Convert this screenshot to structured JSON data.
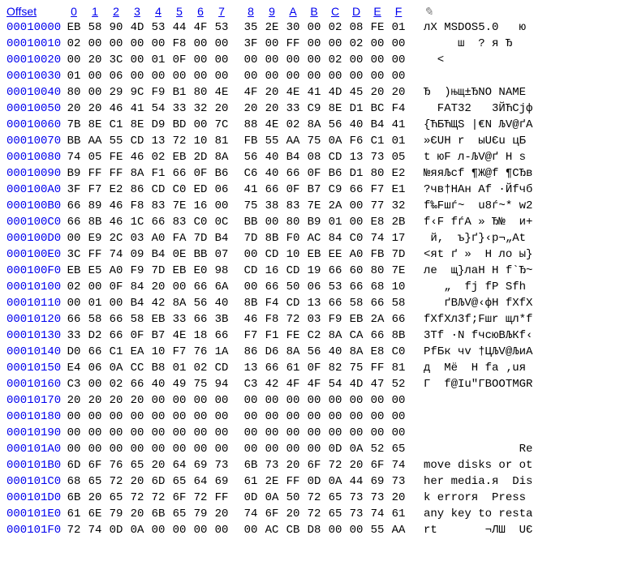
{
  "header": {
    "offset_label": "Offset",
    "columns": [
      "0",
      "1",
      "2",
      "3",
      "4",
      "5",
      "6",
      "7",
      "8",
      "9",
      "A",
      "B",
      "C",
      "D",
      "E",
      "F"
    ],
    "ascii_header_icon": "slash-icon"
  },
  "rows": [
    {
      "offset": "00010000",
      "hex": [
        "EB",
        "58",
        "90",
        "4D",
        "53",
        "44",
        "4F",
        "53",
        "35",
        "2E",
        "30",
        "00",
        "02",
        "08",
        "FE",
        "01"
      ],
      "ascii": "лX MSDOS5.0   ю"
    },
    {
      "offset": "00010010",
      "hex": [
        "02",
        "00",
        "00",
        "00",
        "00",
        "F8",
        "00",
        "00",
        "3F",
        "00",
        "FF",
        "00",
        "00",
        "02",
        "00",
        "00"
      ],
      "ascii": "     ш  ? я Ђ"
    },
    {
      "offset": "00010020",
      "hex": [
        "00",
        "20",
        "3C",
        "00",
        "01",
        "0F",
        "00",
        "00",
        "00",
        "00",
        "00",
        "00",
        "02",
        "00",
        "00",
        "00"
      ],
      "ascii": "  <"
    },
    {
      "offset": "00010030",
      "hex": [
        "01",
        "00",
        "06",
        "00",
        "00",
        "00",
        "00",
        "00",
        "00",
        "00",
        "00",
        "00",
        "00",
        "00",
        "00",
        "00"
      ],
      "ascii": ""
    },
    {
      "offset": "00010040",
      "hex": [
        "80",
        "00",
        "29",
        "9C",
        "F9",
        "B1",
        "80",
        "4E",
        "4F",
        "20",
        "4E",
        "41",
        "4D",
        "45",
        "20",
        "20"
      ],
      "ascii": "Ђ  )њщ±ЂNO NAME"
    },
    {
      "offset": "00010050",
      "hex": [
        "20",
        "20",
        "46",
        "41",
        "54",
        "33",
        "32",
        "20",
        "20",
        "20",
        "33",
        "C9",
        "8E",
        "D1",
        "BC",
        "F4"
      ],
      "ascii": "  FAT32   3ЙЋСјф"
    },
    {
      "offset": "00010060",
      "hex": [
        "7B",
        "8E",
        "C1",
        "8E",
        "D9",
        "BD",
        "00",
        "7C",
        "88",
        "4E",
        "02",
        "8A",
        "56",
        "40",
        "B4",
        "41"
      ],
      "ascii": "{ЋБЋЩЅ |€N ЉV@ґA"
    },
    {
      "offset": "00010070",
      "hex": [
        "BB",
        "AA",
        "55",
        "CD",
        "13",
        "72",
        "10",
        "81",
        "FB",
        "55",
        "AA",
        "75",
        "0A",
        "F6",
        "C1",
        "01"
      ],
      "ascii": "»ЄUН r  ыUЄu цБ"
    },
    {
      "offset": "00010080",
      "hex": [
        "74",
        "05",
        "FE",
        "46",
        "02",
        "EB",
        "2D",
        "8A",
        "56",
        "40",
        "B4",
        "08",
        "CD",
        "13",
        "73",
        "05"
      ],
      "ascii": "t юF л-ЉV@ґ Н s"
    },
    {
      "offset": "00010090",
      "hex": [
        "B9",
        "FF",
        "FF",
        "8A",
        "F1",
        "66",
        "0F",
        "B6",
        "C6",
        "40",
        "66",
        "0F",
        "B6",
        "D1",
        "80",
        "E2"
      ],
      "ascii": "№яяЉсf ¶Ж@f ¶СЂв"
    },
    {
      "offset": "000100A0",
      "hex": [
        "3F",
        "F7",
        "E2",
        "86",
        "CD",
        "C0",
        "ED",
        "06",
        "41",
        "66",
        "0F",
        "B7",
        "C9",
        "66",
        "F7",
        "E1"
      ],
      "ascii": "?чв†НАн Af ·Йfчб"
    },
    {
      "offset": "000100B0",
      "hex": [
        "66",
        "89",
        "46",
        "F8",
        "83",
        "7E",
        "16",
        "00",
        "75",
        "38",
        "83",
        "7E",
        "2A",
        "00",
        "77",
        "32"
      ],
      "ascii": "f‰Fшѓ~  u8ѓ~* w2"
    },
    {
      "offset": "000100C0",
      "hex": [
        "66",
        "8B",
        "46",
        "1C",
        "66",
        "83",
        "C0",
        "0C",
        "BB",
        "00",
        "80",
        "B9",
        "01",
        "00",
        "E8",
        "2B"
      ],
      "ascii": "f‹F fѓА » Ђ№  и+"
    },
    {
      "offset": "000100D0",
      "hex": [
        "00",
        "E9",
        "2C",
        "03",
        "A0",
        "FA",
        "7D",
        "B4",
        "7D",
        "8B",
        "F0",
        "AC",
        "84",
        "C0",
        "74",
        "17"
      ],
      "ascii": " й,  ъ}ґ}‹р¬„Аt"
    },
    {
      "offset": "000100E0",
      "hex": [
        "3C",
        "FF",
        "74",
        "09",
        "B4",
        "0E",
        "BB",
        "07",
        "00",
        "CD",
        "10",
        "EB",
        "EE",
        "A0",
        "FB",
        "7D"
      ],
      "ascii": "<яt ґ »  Н ло ы}"
    },
    {
      "offset": "000100F0",
      "hex": [
        "EB",
        "E5",
        "A0",
        "F9",
        "7D",
        "EB",
        "E0",
        "98",
        "CD",
        "16",
        "CD",
        "19",
        "66",
        "60",
        "80",
        "7E"
      ],
      "ascii": "ле  щ}лаН Н f`Ђ~"
    },
    {
      "offset": "00010100",
      "hex": [
        "02",
        "00",
        "0F",
        "84",
        "20",
        "00",
        "66",
        "6A",
        "00",
        "66",
        "50",
        "06",
        "53",
        "66",
        "68",
        "10"
      ],
      "ascii": "   „  fj fP Sfh"
    },
    {
      "offset": "00010110",
      "hex": [
        "00",
        "01",
        "00",
        "B4",
        "42",
        "8A",
        "56",
        "40",
        "8B",
        "F4",
        "CD",
        "13",
        "66",
        "58",
        "66",
        "58"
      ],
      "ascii": "   ґBЉV@‹фН fXfX"
    },
    {
      "offset": "00010120",
      "hex": [
        "66",
        "58",
        "66",
        "58",
        "EB",
        "33",
        "66",
        "3B",
        "46",
        "F8",
        "72",
        "03",
        "F9",
        "EB",
        "2A",
        "66"
      ],
      "ascii": "fXfXл3f;Fшr щл*f"
    },
    {
      "offset": "00010130",
      "hex": [
        "33",
        "D2",
        "66",
        "0F",
        "B7",
        "4E",
        "18",
        "66",
        "F7",
        "F1",
        "FE",
        "C2",
        "8A",
        "CA",
        "66",
        "8B"
      ],
      "ascii": "3Тf ·N fчсюВЉКf‹"
    },
    {
      "offset": "00010140",
      "hex": [
        "D0",
        "66",
        "C1",
        "EA",
        "10",
        "F7",
        "76",
        "1A",
        "86",
        "D6",
        "8A",
        "56",
        "40",
        "8A",
        "E8",
        "C0"
      ],
      "ascii": "РfБк чv †ЦЉV@ЉиА"
    },
    {
      "offset": "00010150",
      "hex": [
        "E4",
        "06",
        "0A",
        "CC",
        "B8",
        "01",
        "02",
        "CD",
        "13",
        "66",
        "61",
        "0F",
        "82",
        "75",
        "FF",
        "81"
      ],
      "ascii": "д  Мё  Н fa ‚uя"
    },
    {
      "offset": "00010160",
      "hex": [
        "C3",
        "00",
        "02",
        "66",
        "40",
        "49",
        "75",
        "94",
        "C3",
        "42",
        "4F",
        "4F",
        "54",
        "4D",
        "47",
        "52"
      ],
      "ascii": "Г  f@Iu\"ГBOOTMGR"
    },
    {
      "offset": "00010170",
      "hex": [
        "20",
        "20",
        "20",
        "20",
        "00",
        "00",
        "00",
        "00",
        "00",
        "00",
        "00",
        "00",
        "00",
        "00",
        "00",
        "00"
      ],
      "ascii": ""
    },
    {
      "offset": "00010180",
      "hex": [
        "00",
        "00",
        "00",
        "00",
        "00",
        "00",
        "00",
        "00",
        "00",
        "00",
        "00",
        "00",
        "00",
        "00",
        "00",
        "00"
      ],
      "ascii": ""
    },
    {
      "offset": "00010190",
      "hex": [
        "00",
        "00",
        "00",
        "00",
        "00",
        "00",
        "00",
        "00",
        "00",
        "00",
        "00",
        "00",
        "00",
        "00",
        "00",
        "00"
      ],
      "ascii": ""
    },
    {
      "offset": "000101A0",
      "hex": [
        "00",
        "00",
        "00",
        "00",
        "00",
        "00",
        "00",
        "00",
        "00",
        "00",
        "00",
        "00",
        "0D",
        "0A",
        "52",
        "65"
      ],
      "ascii": "              Re"
    },
    {
      "offset": "000101B0",
      "hex": [
        "6D",
        "6F",
        "76",
        "65",
        "20",
        "64",
        "69",
        "73",
        "6B",
        "73",
        "20",
        "6F",
        "72",
        "20",
        "6F",
        "74"
      ],
      "ascii": "move disks or ot"
    },
    {
      "offset": "000101C0",
      "hex": [
        "68",
        "65",
        "72",
        "20",
        "6D",
        "65",
        "64",
        "69",
        "61",
        "2E",
        "FF",
        "0D",
        "0A",
        "44",
        "69",
        "73"
      ],
      "ascii": "her media.я  Dis"
    },
    {
      "offset": "000101D0",
      "hex": [
        "6B",
        "20",
        "65",
        "72",
        "72",
        "6F",
        "72",
        "FF",
        "0D",
        "0A",
        "50",
        "72",
        "65",
        "73",
        "73",
        "20"
      ],
      "ascii": "k errorя  Press"
    },
    {
      "offset": "000101E0",
      "hex": [
        "61",
        "6E",
        "79",
        "20",
        "6B",
        "65",
        "79",
        "20",
        "74",
        "6F",
        "20",
        "72",
        "65",
        "73",
        "74",
        "61"
      ],
      "ascii": "any key to resta"
    },
    {
      "offset": "000101F0",
      "hex": [
        "72",
        "74",
        "0D",
        "0A",
        "00",
        "00",
        "00",
        "00",
        "00",
        "AC",
        "CB",
        "D8",
        "00",
        "00",
        "55",
        "AA"
      ],
      "ascii": "rt       ¬ЛШ  UЄ"
    }
  ]
}
